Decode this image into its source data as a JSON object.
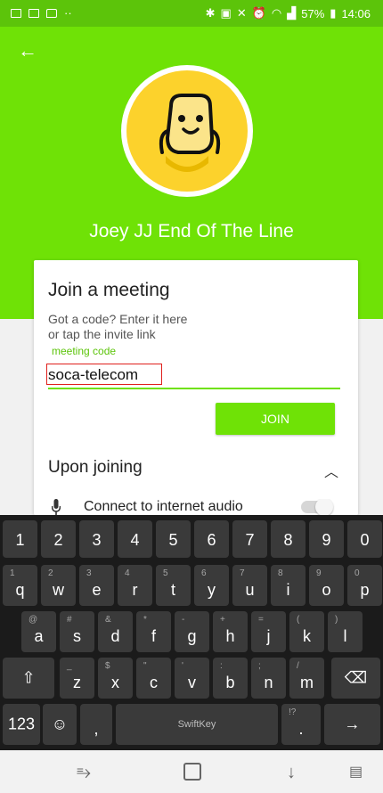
{
  "status": {
    "battery": "57%",
    "time": "14:06"
  },
  "header": {
    "user_name": "Joey JJ End Of The Line"
  },
  "card": {
    "title": "Join a meeting",
    "desc_line1": "Got a code? Enter it here",
    "desc_line2": "or tap the invite link",
    "code_label": "meeting code",
    "code_value": "soca-telecom",
    "join_label": "JOIN",
    "section_title": "Upon joining",
    "audio_label": "Connect to internet audio",
    "audio_enabled": false
  },
  "keyboard": {
    "number_row": [
      "1",
      "2",
      "3",
      "4",
      "5",
      "6",
      "7",
      "8",
      "9",
      "0"
    ],
    "row1": [
      {
        "main": "q",
        "alt": "1"
      },
      {
        "main": "w",
        "alt": "2"
      },
      {
        "main": "e",
        "alt": "3"
      },
      {
        "main": "r",
        "alt": "4"
      },
      {
        "main": "t",
        "alt": "5"
      },
      {
        "main": "y",
        "alt": "6"
      },
      {
        "main": "u",
        "alt": "7"
      },
      {
        "main": "i",
        "alt": "8"
      },
      {
        "main": "o",
        "alt": "9"
      },
      {
        "main": "p",
        "alt": "0"
      }
    ],
    "row2": [
      {
        "main": "a",
        "alt": "@"
      },
      {
        "main": "s",
        "alt": "#"
      },
      {
        "main": "d",
        "alt": "&"
      },
      {
        "main": "f",
        "alt": "*"
      },
      {
        "main": "g",
        "alt": "-"
      },
      {
        "main": "h",
        "alt": "+"
      },
      {
        "main": "j",
        "alt": "="
      },
      {
        "main": "k",
        "alt": "("
      },
      {
        "main": "l",
        "alt": ")"
      }
    ],
    "row3": [
      {
        "main": "z",
        "alt": "_"
      },
      {
        "main": "x",
        "alt": "$"
      },
      {
        "main": "c",
        "alt": "\""
      },
      {
        "main": "v",
        "alt": "'"
      },
      {
        "main": "b",
        "alt": ":"
      },
      {
        "main": "n",
        "alt": ";"
      },
      {
        "main": "m",
        "alt": "/"
      }
    ],
    "shift_glyph": "⇧",
    "backspace_glyph": "⌫",
    "symbols_label": "123",
    "emoji_glyph": "☺",
    "comma_label": ",",
    "space_label": "SwiftKey",
    "period_label": ".",
    "period_alt": "!?",
    "enter_glyph": "→"
  },
  "colors": {
    "brand_green": "#6fe206",
    "status_green": "#5cc40a",
    "avatar_yellow": "#fcd22c",
    "highlight_red": "#e0201c"
  },
  "icons": [
    "back-arrow-icon",
    "bluetooth-icon",
    "wifi-icon",
    "battery-icon",
    "microphone-icon",
    "chevron-up-icon",
    "swiftkey-logo-icon"
  ]
}
